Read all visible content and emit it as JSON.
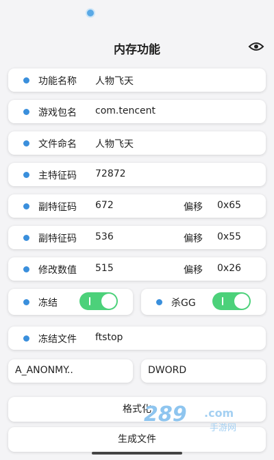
{
  "page": {
    "title": "内存功能"
  },
  "rows": [
    {
      "label": "功能名称",
      "value": "人物飞天"
    },
    {
      "label": "游戏包名",
      "value": "com.tencent"
    },
    {
      "label": "文件命名",
      "value": "人物飞天"
    },
    {
      "label": "主特征码",
      "value": "72872"
    },
    {
      "label": "副特征码",
      "value": "672",
      "offset_label": "偏移",
      "offset_value": "0x65"
    },
    {
      "label": "副特征码",
      "value": "536",
      "offset_label": "偏移",
      "offset_value": "0x55"
    },
    {
      "label": "修改数值",
      "value": "515",
      "offset_label": "偏移",
      "offset_value": "0x26"
    }
  ],
  "toggles": [
    {
      "label": "冻结",
      "on": true
    },
    {
      "label": "杀GG",
      "on": true
    }
  ],
  "freeze_file": {
    "label": "冻结文件",
    "value": "ftstop"
  },
  "selects": {
    "left": "A_ANONMY..",
    "right": "DWORD"
  },
  "buttons": {
    "format": "格式化",
    "generate": "生成文件"
  },
  "watermark": {
    "number": "289",
    "suffix": ".com",
    "sub": "手游网"
  },
  "colors": {
    "accent": "#3a8fdc",
    "toggle_on": "#4cd17a",
    "background": "#f4f4f6"
  }
}
